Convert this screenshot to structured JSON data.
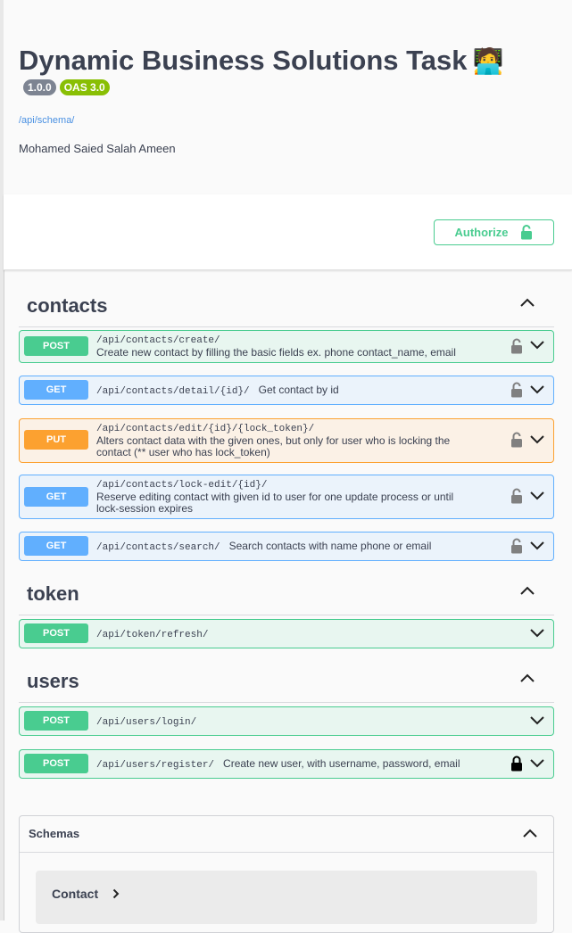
{
  "info": {
    "title": "Dynamic Business Solutions Task",
    "title_emoji": "🧑‍💻",
    "version_badge": "1.0.0",
    "oas_badge": "OAS 3.0",
    "schema_link": "/api/schema/",
    "description": "Mohamed Saied Salah Ameen"
  },
  "authorize": {
    "label": "Authorize",
    "icon": "unlocked-padlock-icon"
  },
  "tags": {
    "contacts": "contacts",
    "token": "token",
    "users": "users"
  },
  "operations": [
    {
      "method": "POST",
      "path": "/api/contacts/create/",
      "summary": "Create new contact by filling the basic fields ex. phone contact_name, email",
      "lock": "unlocked"
    },
    {
      "method": "GET",
      "path": "/api/contacts/detail/{id}/",
      "summary": "Get contact by id",
      "lock": "unlocked"
    },
    {
      "method": "PUT",
      "path": "/api/contacts/edit/{id}/{lock_token}/",
      "summary": "Alters contact data with the given ones, but only for user who is locking the contact (** user who has lock_token)",
      "lock": "unlocked"
    },
    {
      "method": "GET",
      "path": "/api/contacts/lock-edit/{id}/",
      "summary": "Reserve editing contact with given id to user for one update process or until lock-session expires",
      "lock": "unlocked"
    },
    {
      "method": "GET",
      "path": "/api/contacts/search/",
      "summary": "Search contacts with name phone or email",
      "lock": "unlocked"
    },
    {
      "method": "POST",
      "path": "/api/token/refresh/",
      "summary": "",
      "lock": "none"
    },
    {
      "method": "POST",
      "path": "/api/users/login/",
      "summary": "",
      "lock": "none"
    },
    {
      "method": "POST",
      "path": "/api/users/register/",
      "summary": "Create new user, with username, password, email",
      "lock": "locked"
    }
  ],
  "schemas": {
    "title": "Schemas",
    "models": [
      "Contact"
    ]
  },
  "colors": {
    "post": "#49cc90",
    "get": "#61affe",
    "put": "#fca130",
    "link": "#4990e2"
  }
}
